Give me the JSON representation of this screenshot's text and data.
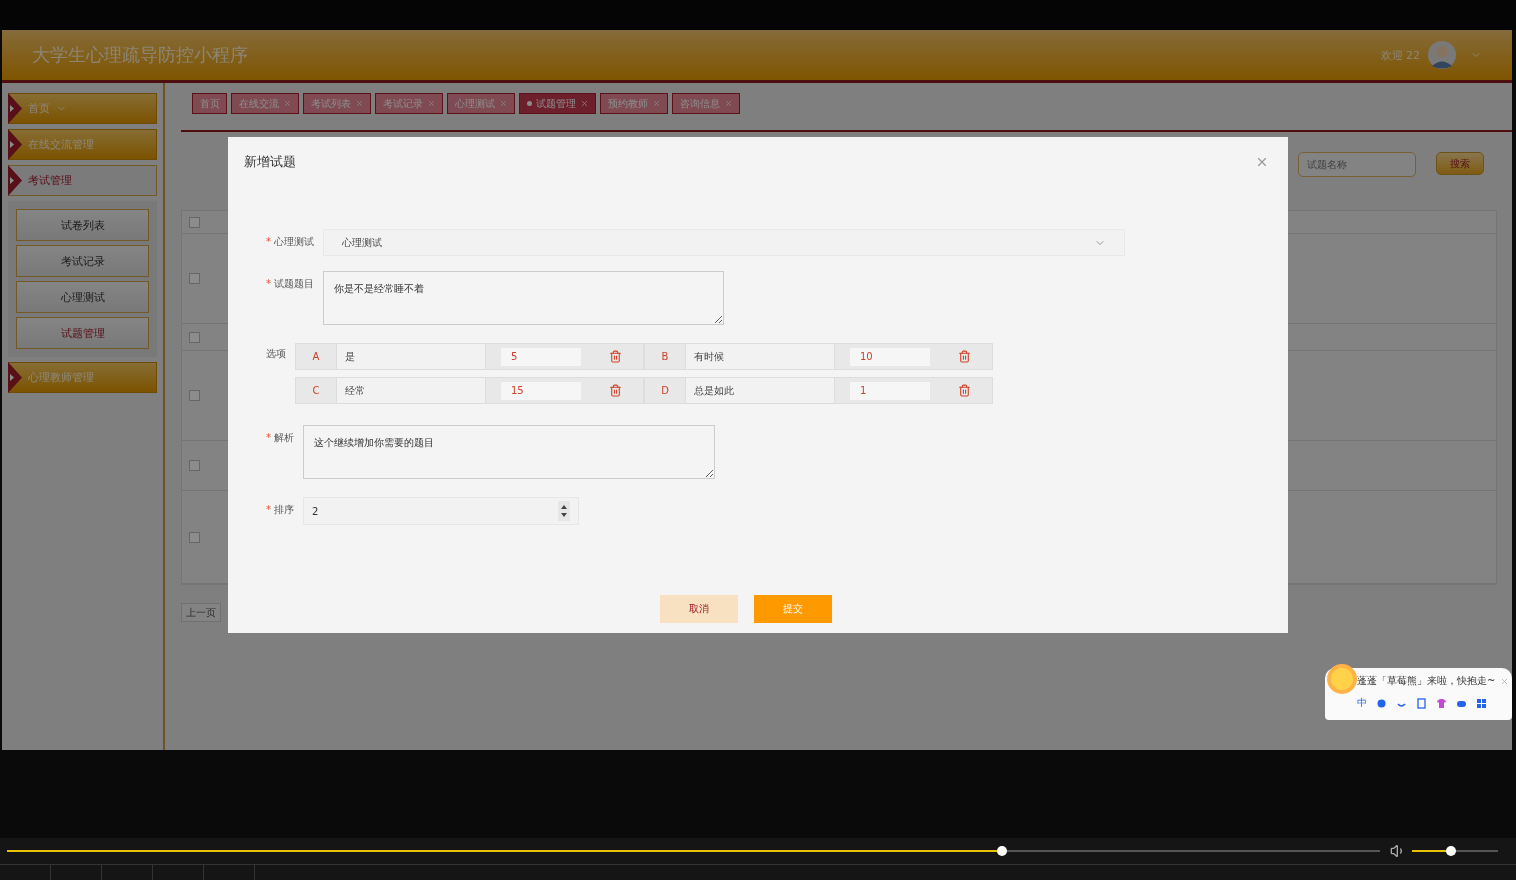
{
  "app": {
    "title": "大学生心理疏导防控小程序",
    "welcome": "欢迎 22"
  },
  "sidebar": {
    "items": [
      {
        "label": "首页",
        "dropdown": true,
        "expanded": false
      },
      {
        "label": "在线交流管理",
        "dropdown": false,
        "expanded": false
      },
      {
        "label": "考试管理",
        "dropdown": false,
        "expanded": true,
        "children": [
          {
            "label": "试卷列表",
            "selected": false
          },
          {
            "label": "考试记录",
            "selected": false
          },
          {
            "label": "心理测试",
            "selected": false
          },
          {
            "label": "试题管理",
            "selected": true
          }
        ]
      },
      {
        "label": "心理教师管理",
        "dropdown": false,
        "expanded": false
      }
    ]
  },
  "tabs": [
    {
      "label": "首页",
      "closable": false,
      "selected": false
    },
    {
      "label": "在线交流",
      "closable": true,
      "selected": false
    },
    {
      "label": "考试列表",
      "closable": true,
      "selected": false
    },
    {
      "label": "考试记录",
      "closable": true,
      "selected": false
    },
    {
      "label": "心理测试",
      "closable": true,
      "selected": false
    },
    {
      "label": "试题管理",
      "closable": true,
      "selected": true
    },
    {
      "label": "预约教师",
      "closable": true,
      "selected": false
    },
    {
      "label": "咨询信息",
      "closable": true,
      "selected": false
    }
  ],
  "search": {
    "placeholder": "试题名称",
    "button": "搜索"
  },
  "table": {
    "header_checked": false,
    "rows": [
      {
        "checked": false
      },
      {
        "checked": false
      },
      {
        "checked": false
      },
      {
        "checked": false
      },
      {
        "checked": false
      }
    ]
  },
  "pagination": {
    "prev": "上一页"
  },
  "modal": {
    "title": "新增试题",
    "fields": [
      {
        "kind": "select",
        "label": "心理测试",
        "required_mark": "*",
        "value": "心理测试"
      },
      {
        "kind": "textarea",
        "label": "试题题目",
        "required_mark": "*",
        "value": "你是不是经常睡不着"
      },
      {
        "kind": "options",
        "label": "选项",
        "options": [
          {
            "letter": "A",
            "text": "是",
            "score": "5"
          },
          {
            "letter": "B",
            "text": "有时候",
            "score": "10"
          },
          {
            "letter": "C",
            "text": "经常",
            "score": "15"
          },
          {
            "letter": "D",
            "text": "总是如此",
            "score": "1"
          }
        ]
      },
      {
        "kind": "textarea",
        "label": "解析",
        "required_mark": "*",
        "value": "这个继续增加你需要的题目"
      },
      {
        "kind": "number",
        "label": "排序",
        "required_mark": "*",
        "value": "2"
      }
    ],
    "buttons": [
      {
        "kind": "cancel",
        "label": "取消"
      },
      {
        "kind": "submit",
        "label": "提交"
      }
    ]
  },
  "player": {
    "progress": {
      "level": 0.725
    },
    "volume": {
      "level": 0.45
    }
  },
  "ime": {
    "message": "蓬蓬「草莓熊」来啦，快抱走~",
    "mode": "中"
  }
}
